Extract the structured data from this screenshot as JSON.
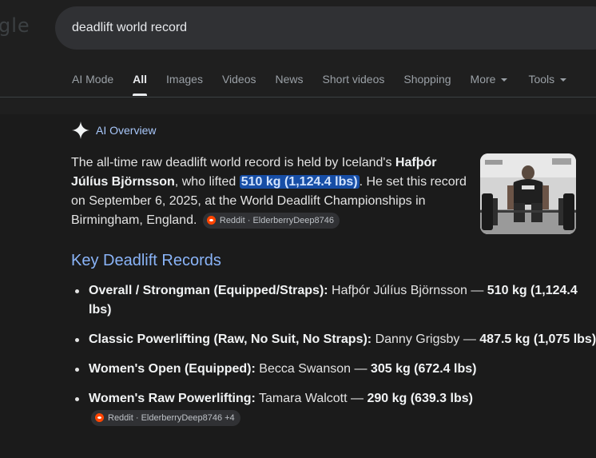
{
  "logo_fragment": "gle",
  "search": {
    "query": "deadlift world record"
  },
  "tabs": [
    {
      "label": "AI Mode"
    },
    {
      "label": "All"
    },
    {
      "label": "Images"
    },
    {
      "label": "Videos"
    },
    {
      "label": "News"
    },
    {
      "label": "Short videos"
    },
    {
      "label": "Shopping"
    },
    {
      "label": "More"
    },
    {
      "label": "Tools"
    }
  ],
  "ai_overview": {
    "label": "AI Overview",
    "summary_part1": "The all-time raw deadlift world record is held by Iceland's ",
    "summary_name": "Hafþór Júlíus Björnsson",
    "summary_part2": ", who lifted ",
    "summary_highlight": "510 kg (1,124.4 lbs)",
    "summary_part3": ". He set this record on September 6, 2025, at the World Deadlift Championships in Birmingham, England.",
    "summary_source": "Reddit · ElderberryDeep8746",
    "image_icon": "strongman-deadlift-photo"
  },
  "key_records": {
    "title": "Key Deadlift Records",
    "items": [
      {
        "category": "Overall / Strongman (Equipped/Straps):",
        "holder": " Hafþór Júlíus Björnsson — ",
        "weight": "510 kg (1,124.4 lbs)"
      },
      {
        "category": "Classic Powerlifting (Raw, No Suit, No Straps):",
        "holder": " Danny Grigsby — ",
        "weight": "487.5 kg (1,075 lbs)"
      },
      {
        "category": "Women's Open (Equipped):",
        "holder": " Becca Swanson — ",
        "weight": "305 kg (672.4 lbs)"
      },
      {
        "category": "Women's Raw Powerlifting:",
        "holder": " Tamara Walcott — ",
        "weight": "290 kg (639.3 lbs)",
        "source": "Reddit · ElderberryDeep8746 +4"
      }
    ]
  },
  "colors": {
    "accent_blue": "#8ab4f8",
    "highlight": "#174ea6",
    "reddit": "#ff4500"
  }
}
